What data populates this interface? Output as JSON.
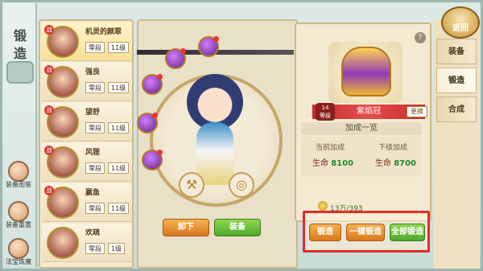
{
  "rail": {
    "title": "锻造",
    "buttons": [
      {
        "label": "装备图鉴"
      },
      {
        "label": "装备重置"
      },
      {
        "label": "法宝炼魔"
      }
    ]
  },
  "heroes": [
    {
      "name": "机灵的颜翠",
      "rank": "零段",
      "level": "11级",
      "selected": true
    },
    {
      "name": "强良",
      "rank": "零段",
      "level": "11级",
      "selected": false
    },
    {
      "name": "望舒",
      "rank": "零段",
      "level": "11级",
      "selected": false
    },
    {
      "name": "风狸",
      "rank": "零段",
      "level": "11级",
      "selected": false
    },
    {
      "name": "嬴鱼",
      "rank": "零段",
      "level": "11级",
      "selected": false
    },
    {
      "name": "欢疏",
      "rank": "零段",
      "level": "1级",
      "selected": false
    }
  ],
  "character": {
    "unequip_label": "卸下",
    "equip_label": "装备"
  },
  "item": {
    "level_line1": "14",
    "level_line2": "等级",
    "name": "紫焰冠",
    "swap_label": "更换",
    "help": "?"
  },
  "bonus": {
    "title": "加成一览",
    "current_header": "当前加成",
    "next_header": "下级加成",
    "current_stat": "生命",
    "current_value": "8100",
    "next_stat": "生命",
    "next_value": "8700"
  },
  "cost": {
    "text": "13万/393"
  },
  "forge": {
    "forge_label": "锻造",
    "one_click_label": "一键锻造",
    "all_label": "全部锻造"
  },
  "tabs": [
    {
      "label": "装备",
      "active": false
    },
    {
      "label": "锻造",
      "active": true
    },
    {
      "label": "合成",
      "active": false
    }
  ],
  "back_label": "返回",
  "colors": {
    "accent_red": "#e62a2a",
    "forge_orange": "#d9791f",
    "forge_green": "#4fa72b"
  }
}
